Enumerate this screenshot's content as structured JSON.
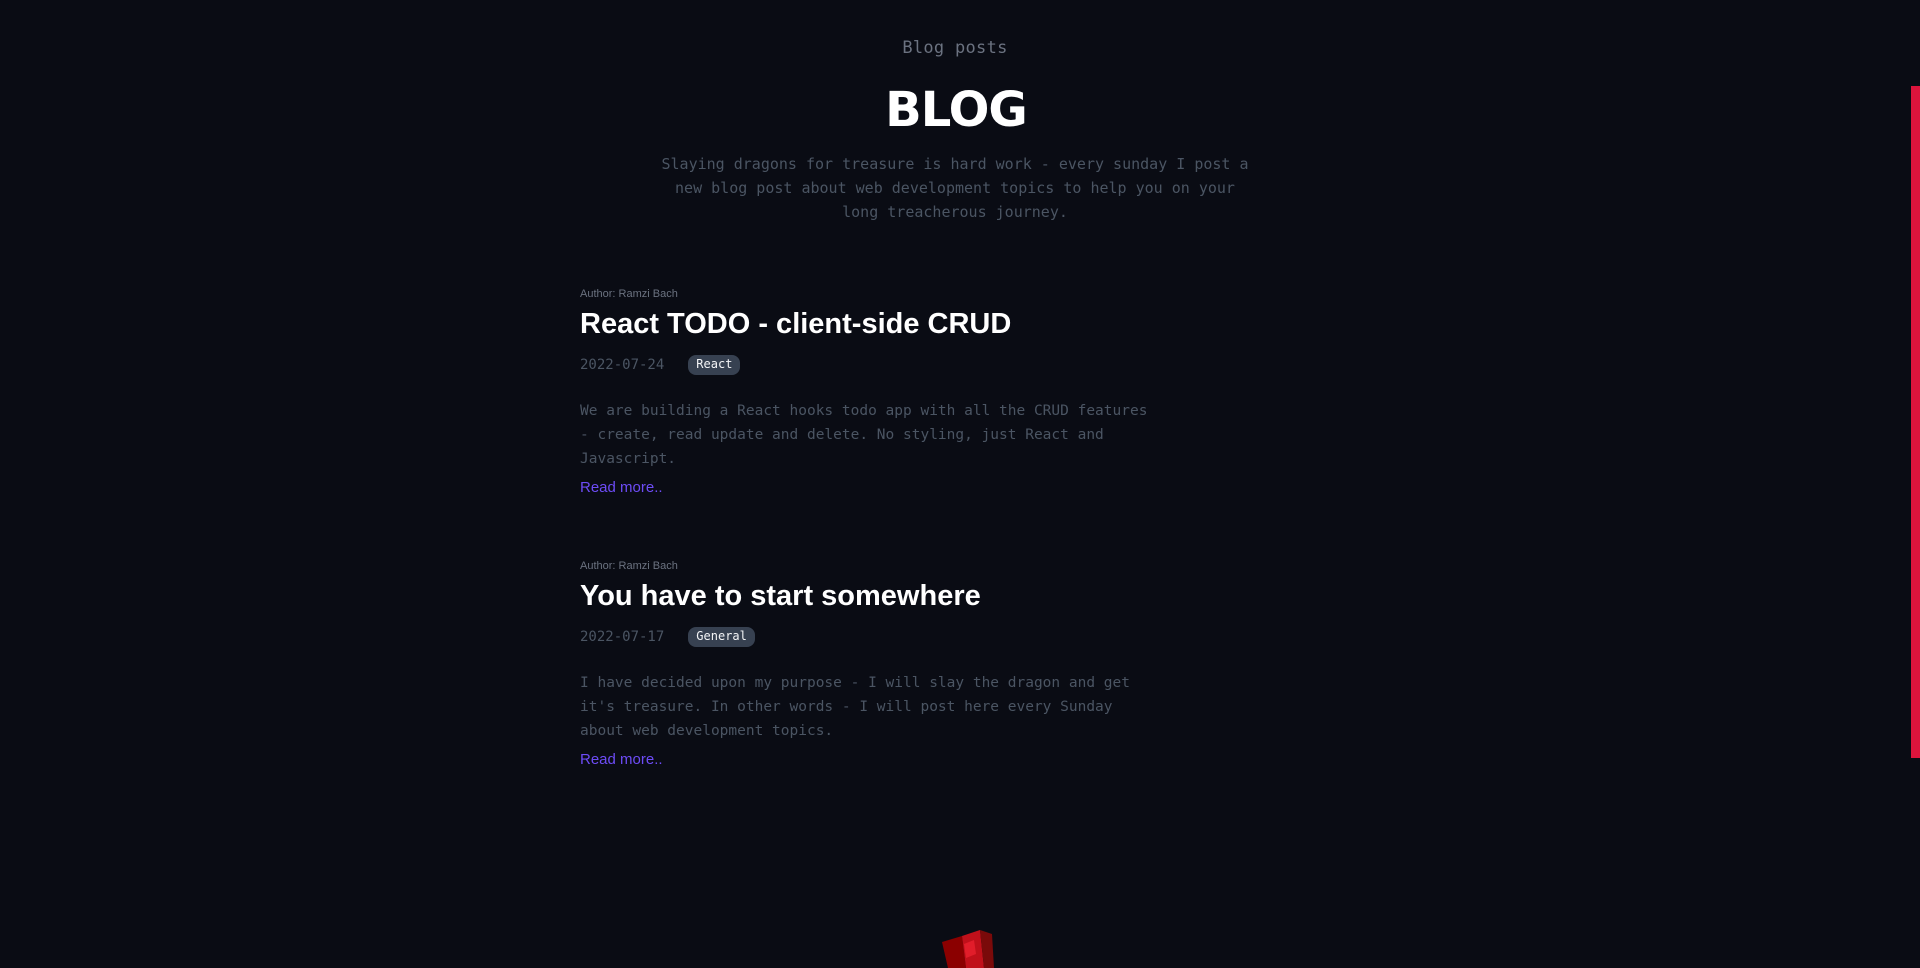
{
  "header": {
    "eyebrow": "Blog posts",
    "title": "BLOG",
    "intro": "Slaying dragons for treasure is hard work - every sunday I post a new blog post about web development topics to help you on your long treacherous journey."
  },
  "posts": [
    {
      "author": "Author: Ramzi Bach",
      "title": "React TODO - client-side CRUD",
      "date": "2022-07-24",
      "tag": "React",
      "excerpt": "We are building a React hooks todo app with all the CRUD features - create, read update and delete. No styling, just React and Javascript.",
      "read_more": "Read more.."
    },
    {
      "author": "Author: Ramzi Bach",
      "title": "You have to start somewhere",
      "date": "2022-07-17",
      "tag": "General",
      "excerpt": "I have decided upon my purpose - I will slay the dragon and get it's treasure. In other words - I will post here every Sunday about web development topics.",
      "read_more": "Read more.."
    }
  ],
  "colors": {
    "background": "#0a0c14",
    "accent_bar": "#dc143c",
    "link": "#6d4cf6",
    "tag_bg": "#374151"
  },
  "icons": {
    "footer_logo": "dragon-logo-icon"
  }
}
